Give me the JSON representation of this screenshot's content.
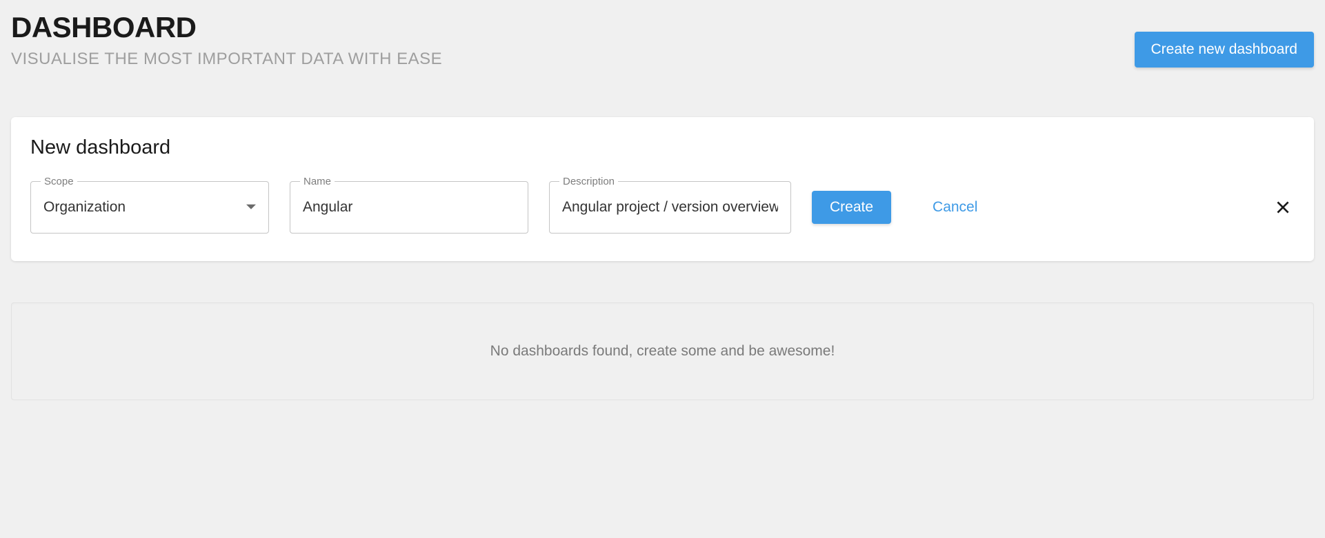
{
  "header": {
    "title": "DASHBOARD",
    "subtitle": "VISUALISE THE MOST IMPORTANT DATA WITH EASE",
    "create_button": "Create new dashboard"
  },
  "new_dashboard": {
    "panel_title": "New dashboard",
    "scope": {
      "label": "Scope",
      "value": "Organization"
    },
    "name": {
      "label": "Name",
      "value": "Angular"
    },
    "description": {
      "label": "Description",
      "value": "Angular project / version overview"
    },
    "create_label": "Create",
    "cancel_label": "Cancel"
  },
  "empty_state": {
    "message": "No dashboards found, create some and be awesome!"
  },
  "colors": {
    "primary": "#3e9ae6",
    "bg": "#f0f0f0",
    "card": "#ffffff",
    "muted": "#7a7a7a"
  }
}
